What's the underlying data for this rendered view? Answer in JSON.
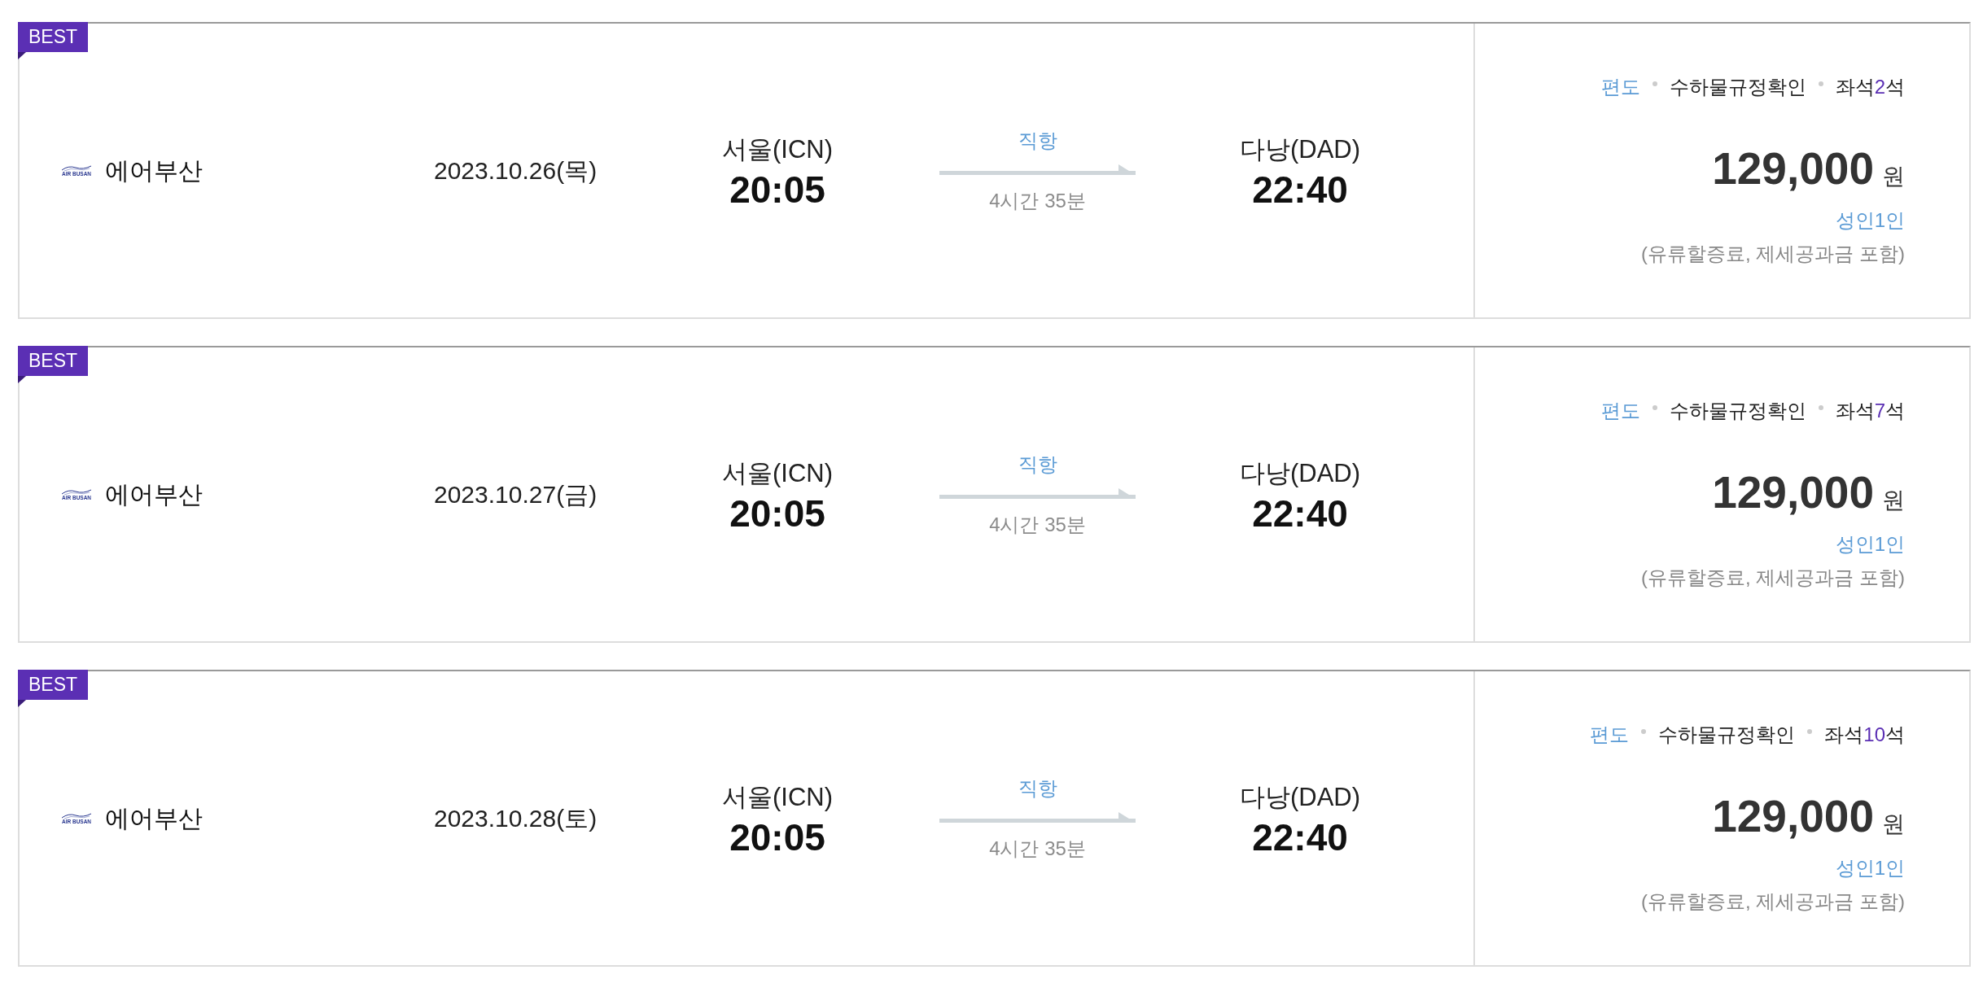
{
  "flights": [
    {
      "badge": "BEST",
      "airline": {
        "logo_text": "AIR BUSAN",
        "name": "에어부산"
      },
      "date": "2023.10.26(목)",
      "departure": {
        "city": "서울(ICN)",
        "time": "20:05"
      },
      "route": {
        "stops": "직항",
        "duration": "4시간 35분"
      },
      "arrival": {
        "city": "다낭(DAD)",
        "time": "22:40"
      },
      "fare": {
        "trip_type": "편도",
        "baggage_link": "수하물규정확인",
        "seats": {
          "before": "좌석",
          "count": "2",
          "after": "석"
        },
        "price": "129,000",
        "currency": "원",
        "passengers": "성인1인",
        "note": "(유류할증료, 제세공과금 포함)"
      }
    },
    {
      "badge": "BEST",
      "airline": {
        "logo_text": "AIR BUSAN",
        "name": "에어부산"
      },
      "date": "2023.10.27(금)",
      "departure": {
        "city": "서울(ICN)",
        "time": "20:05"
      },
      "route": {
        "stops": "직항",
        "duration": "4시간 35분"
      },
      "arrival": {
        "city": "다낭(DAD)",
        "time": "22:40"
      },
      "fare": {
        "trip_type": "편도",
        "baggage_link": "수하물규정확인",
        "seats": {
          "before": "좌석",
          "count": "7",
          "after": "석"
        },
        "price": "129,000",
        "currency": "원",
        "passengers": "성인1인",
        "note": "(유류할증료, 제세공과금 포함)"
      }
    },
    {
      "badge": "BEST",
      "airline": {
        "logo_text": "AIR BUSAN",
        "name": "에어부산"
      },
      "date": "2023.10.28(토)",
      "departure": {
        "city": "서울(ICN)",
        "time": "20:05"
      },
      "route": {
        "stops": "직항",
        "duration": "4시간 35분"
      },
      "arrival": {
        "city": "다낭(DAD)",
        "time": "22:40"
      },
      "fare": {
        "trip_type": "편도",
        "baggage_link": "수하물규정확인",
        "seats": {
          "before": "좌석",
          "count": "10",
          "after": "석"
        },
        "price": "129,000",
        "currency": "원",
        "passengers": "성인1인",
        "note": "(유류할증료, 제세공과금 포함)"
      }
    }
  ]
}
